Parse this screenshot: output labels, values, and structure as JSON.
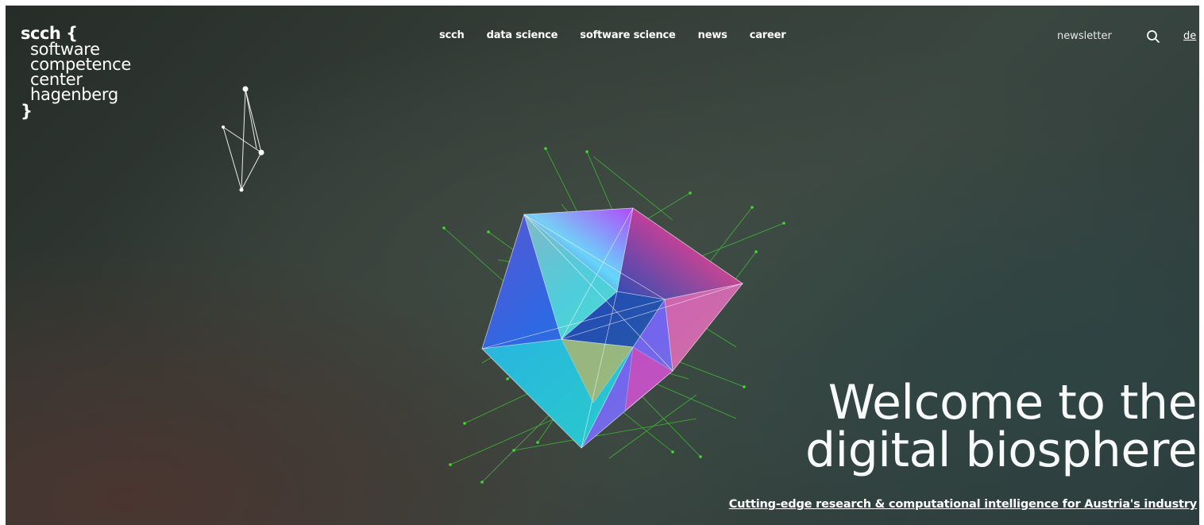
{
  "logo": {
    "brand": "scch {",
    "lines": [
      "software",
      "competence",
      "center",
      "hagenberg"
    ],
    "close": "}"
  },
  "nav": {
    "items": [
      "scch",
      "data science",
      "software science",
      "news",
      "career"
    ]
  },
  "header": {
    "newsletter": "newsletter",
    "search_icon": "search-icon",
    "lang": "de"
  },
  "hero": {
    "headline_line1": "Welcome to the",
    "headline_line2": "digital biosphere",
    "tagline": "Cutting-edge research & computational intelligence for Austria's industry"
  },
  "colors": {
    "background_dark": "#2f3833",
    "background_warm": "#4a3530",
    "text": "#ffffff",
    "network_green": "#3ddc2f"
  }
}
